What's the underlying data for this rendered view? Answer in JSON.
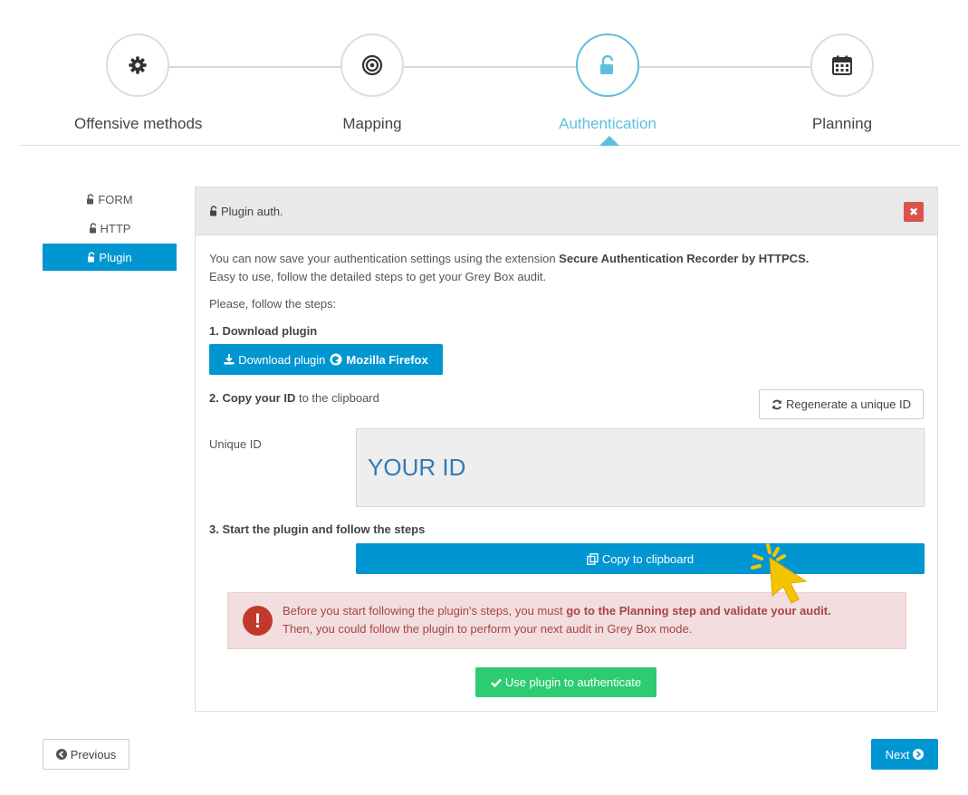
{
  "stepper": {
    "steps": [
      {
        "label": "Offensive methods",
        "icon": "gear-icon"
      },
      {
        "label": "Mapping",
        "icon": "target-icon"
      },
      {
        "label": "Authentication",
        "icon": "unlock-icon",
        "active": true
      },
      {
        "label": "Planning",
        "icon": "calendar-icon"
      }
    ]
  },
  "sidenav": {
    "items": [
      {
        "label": "FORM",
        "icon": "unlock-icon"
      },
      {
        "label": "HTTP",
        "icon": "unlock-icon"
      },
      {
        "label": "Plugin",
        "icon": "unlock-icon",
        "active": true
      }
    ]
  },
  "panel": {
    "title": "Plugin auth.",
    "close_label": "✖",
    "intro_prefix": "You can now save your authentication settings using the extension ",
    "intro_strong": "Secure Authentication Recorder by HTTPCS.",
    "intro_line2": "Easy to use, follow the detailed steps to get your Grey Box audit.",
    "please": "Please, follow the steps:",
    "step1": "1. Download plugin",
    "download_prefix": "Download plugin",
    "download_browser": "Mozilla Firefox",
    "step2_strong": "2. Copy your ID",
    "step2_rest": " to the clipboard",
    "regenerate_label": "Regenerate a unique ID",
    "unique_id_label": "Unique ID",
    "unique_id_value": "YOUR ID",
    "step3": "3. Start the plugin and follow the steps",
    "copy_label": "Copy to clipboard",
    "alert": {
      "prefix": "Before you start following the plugin's steps, you must ",
      "strong": "go to the Planning step and validate your audit.",
      "line2": "Then, you could follow the plugin to perform your next audit in Grey Box mode."
    },
    "use_plugin_label": "Use plugin to authenticate"
  },
  "footer": {
    "previous_label": "Previous",
    "next_label": "Next"
  },
  "colors": {
    "accent": "#0096d1",
    "active_step": "#5bc0de",
    "success": "#2ecc71",
    "danger": "#d9534f",
    "alert_bg": "#f2dede",
    "cursor": "#f5c400"
  }
}
